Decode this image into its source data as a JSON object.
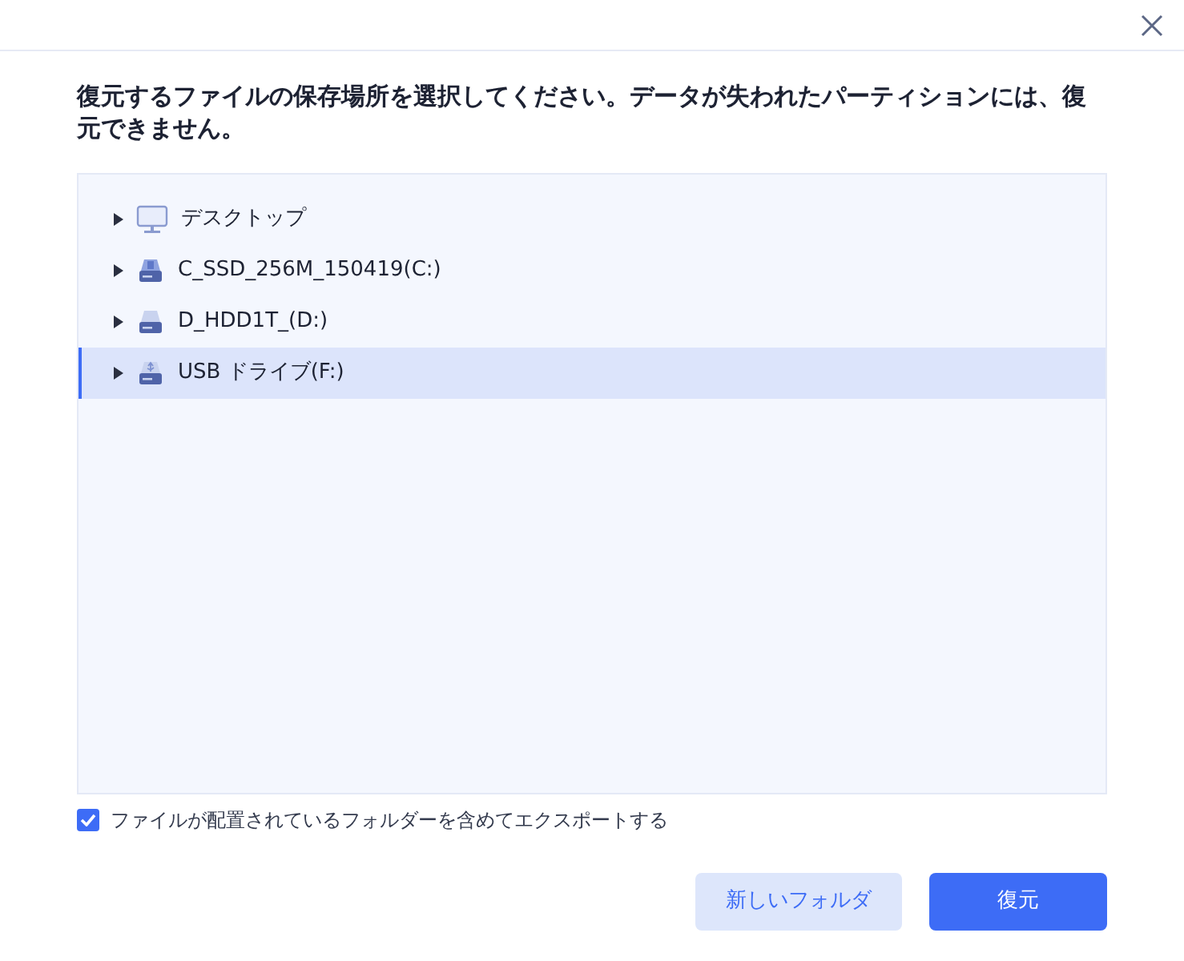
{
  "heading": "復元するファイルの保存場所を選択してください。データが失われたパーティションには、復元できません。",
  "tree": [
    {
      "label": "デスクトップ",
      "kind": "desktop",
      "selected": false
    },
    {
      "label": "C_SSD_256M_150419(C:)",
      "kind": "system-drive",
      "selected": false
    },
    {
      "label": "D_HDD1T_(D:)",
      "kind": "drive",
      "selected": false
    },
    {
      "label": "USB ドライブ(F:)",
      "kind": "usb",
      "selected": true
    }
  ],
  "export_option": {
    "label": "ファイルが配置されているフォルダーを含めてエクスポートする",
    "checked": true
  },
  "buttons": [
    {
      "label": "新しいフォルダ",
      "kind": "secondary"
    },
    {
      "label": "復元",
      "kind": "primary"
    }
  ]
}
